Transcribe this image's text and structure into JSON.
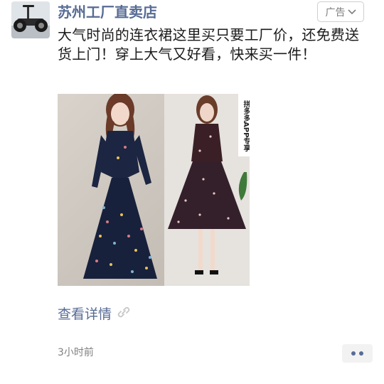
{
  "sender": {
    "name": "苏州工厂直卖店",
    "avatar_icon": "scooter-avatar-icon"
  },
  "ad_tag": {
    "label": "广告",
    "icon": "chevron-down-icon"
  },
  "post": {
    "text": "大气时尚的连衣裙这里买只要工厂价，还免费送货上门！穿上大气又好看，快来买一件！",
    "image_watermark": "拼多多APP专享"
  },
  "details_link": {
    "label": "查看详情",
    "icon": "link-icon"
  },
  "timestamp": "3小时前",
  "more_button": {
    "icon": "more-dots-icon"
  },
  "colors": {
    "link": "#576b95",
    "text": "#1b1b1b",
    "meta": "#808080"
  }
}
